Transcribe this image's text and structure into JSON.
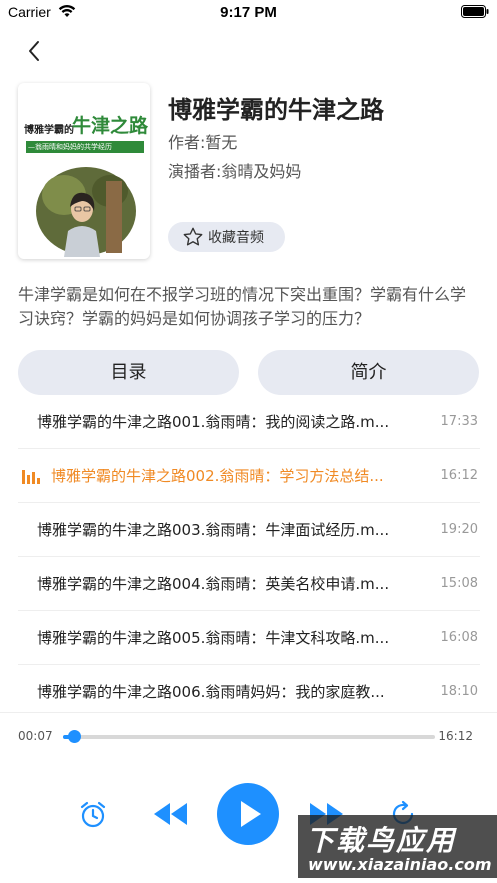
{
  "status_bar": {
    "carrier": "Carrier",
    "time": "9:17 PM"
  },
  "book": {
    "title": "博雅学霸的牛津之路",
    "author": "作者:暂无",
    "narrator": "演播者:翁晴及妈妈",
    "cover": {
      "title_small": "博雅学霸的",
      "title_big": "牛津之路",
      "subtitle": "—翁雨晴和妈妈的共学经历"
    },
    "favorite_label": "收藏音频",
    "description": "牛津学霸是如何在不报学习班的情况下突出重围？学霸有什么学习诀窍？学霸的妈妈是如何协调孩子学习的压力？"
  },
  "tabs": {
    "catalog": "目录",
    "intro": "简介"
  },
  "tracks": [
    {
      "name": "博雅学霸的牛津之路001.翁雨晴：我的阅读之路.m...",
      "duration": "17:33"
    },
    {
      "name": "博雅学霸的牛津之路002.翁雨晴：学习方法总结...",
      "duration": "16:12"
    },
    {
      "name": "博雅学霸的牛津之路003.翁雨晴：牛津面试经历.m...",
      "duration": "19:20"
    },
    {
      "name": "博雅学霸的牛津之路004.翁雨晴：英美名校申请.m...",
      "duration": "15:08"
    },
    {
      "name": "博雅学霸的牛津之路005.翁雨晴：牛津文科攻略.m...",
      "duration": "16:08"
    },
    {
      "name": "博雅学霸的牛津之路006.翁雨晴妈妈：我的家庭教...",
      "duration": "18:10"
    }
  ],
  "active_track_index": 1,
  "player": {
    "elapsed": "00:07",
    "total": "16:12",
    "progress_fraction": 0.007
  },
  "icons": {
    "back": "chevron-left-icon",
    "favorite": "star-outline-icon",
    "now_playing": "equalizer-icon",
    "alarm": "alarm-clock-icon",
    "rewind": "rewind-icon",
    "play": "play-icon",
    "forward": "fast-forward-icon",
    "loop": "loop-icon"
  },
  "colors": {
    "accent": "#1e90ff",
    "active_track": "#f08a24",
    "pill_bg": "#e7eaf2"
  },
  "watermark": {
    "main": "下载鸟应用",
    "url": "www.xiazainiao.com"
  }
}
